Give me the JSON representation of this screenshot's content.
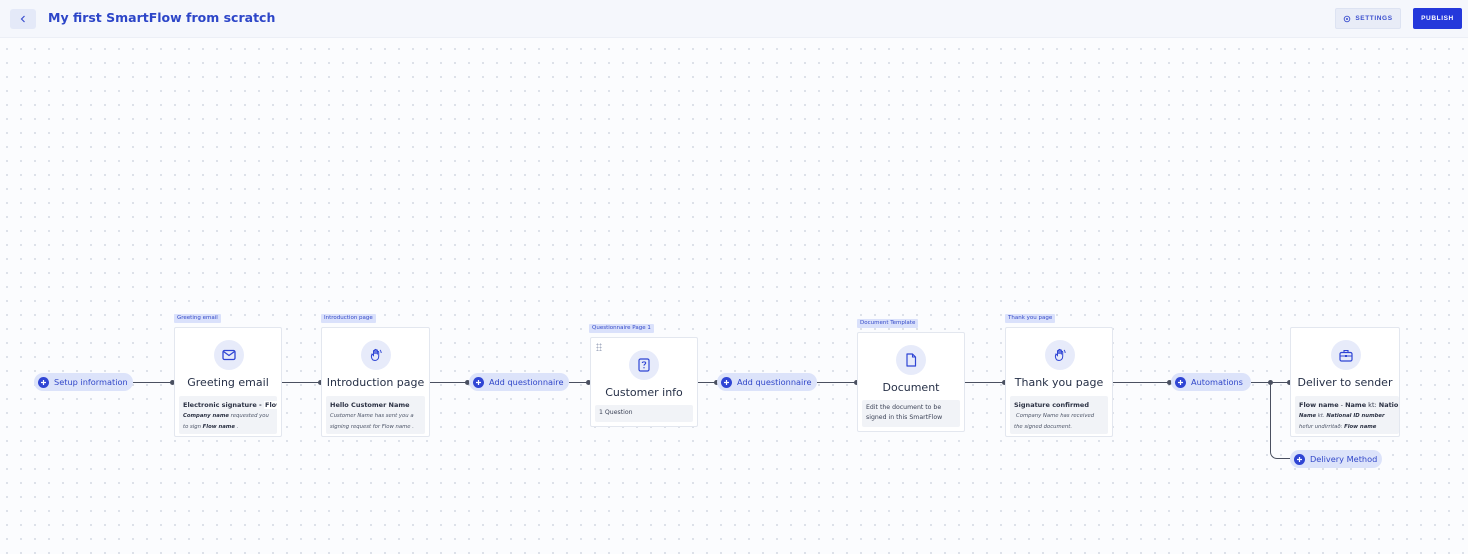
{
  "header": {
    "title": "My first SmartFlow from scratch",
    "settings_label": "SETTINGS",
    "publish_label": "PUBLISH"
  },
  "flow": {
    "setup_pill": "Setup information",
    "add_questionnaire_1": "Add questionnaire",
    "add_questionnaire_2": "Add questionnaire",
    "automations_pill": "Automations",
    "delivery_method_pill": "Delivery Method",
    "greeting": {
      "tag": "Greeting email",
      "title": "Greeting email",
      "line1_a": "Electronic signature - ",
      "line1_b": "Flow n",
      "line2_a": "Company name",
      "line2_b": " requested you",
      "line3_a": "to sign ",
      "line3_b": "Flow name",
      "line3_c": " ."
    },
    "intro": {
      "tag": "Introduction page",
      "title": "Introduction page",
      "line1_a": "Hello ",
      "line1_b": "Customer Name",
      "line2_a": "Customer Name",
      "line2_b": " has sent you a",
      "line3_a": "signing request for ",
      "line3_b": "Flow name",
      "line3_c": " ."
    },
    "questionnaire": {
      "tag": "Questionnaire Page 1",
      "title": "Customer info",
      "count": "1 Question"
    },
    "document": {
      "tag": "Document Template",
      "title": "Document",
      "desc": "Edit the document to be signed in this SmartFlow"
    },
    "thankyou": {
      "tag": "Thank you page",
      "title": "Thank you page",
      "line1": "Signature confirmed",
      "line2_a": "Company Name",
      "line2_b": " has received",
      "line3": "the signed document."
    },
    "deliver": {
      "title": "Deliver to sender",
      "line1_a": "Flow name",
      "line1_b": " - ",
      "line1_c": "Name",
      "line1_d": " kt: ",
      "line1_e": "Natio",
      "line2_a": "Name",
      "line2_b": " kt. ",
      "line2_c": "National ID number",
      "line3_a": "hefur undirritað: ",
      "line3_b": "Flow name"
    }
  },
  "colors": {
    "accent": "#2438db",
    "pill_bg": "#dce3fa",
    "connector": "#4a5060"
  },
  "icons": [
    "chevron-left-icon",
    "gear-icon",
    "plus-icon",
    "envelope-icon",
    "waving-hand-icon",
    "question-icon",
    "document-icon",
    "briefcase-icon"
  ]
}
